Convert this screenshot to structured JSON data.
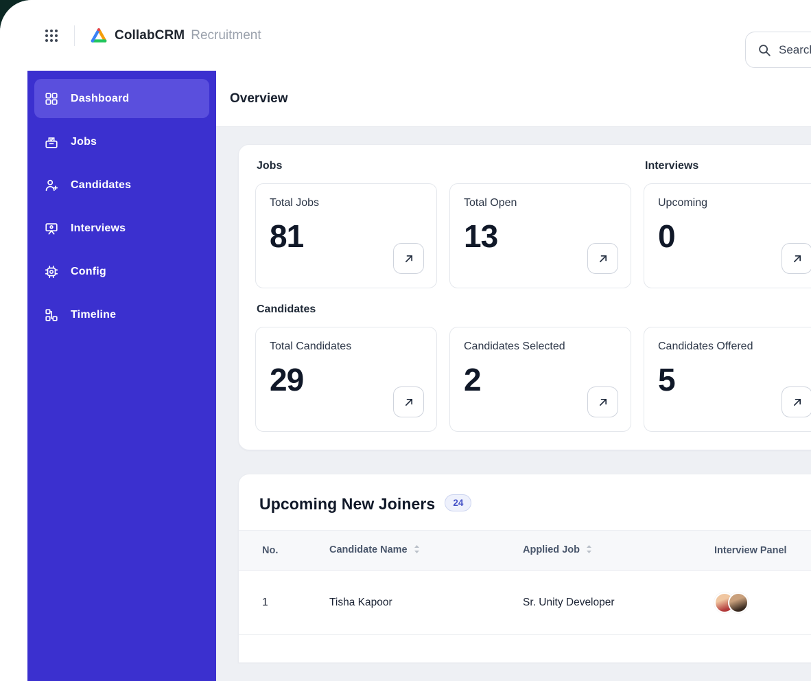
{
  "header": {
    "brand": "CollabCRM",
    "product": "Recruitment",
    "search_placeholder": "Search"
  },
  "sidebar": {
    "items": [
      {
        "label": "Dashboard",
        "icon": "dashboard-icon",
        "active": true
      },
      {
        "label": "Jobs",
        "icon": "jobs-icon",
        "active": false
      },
      {
        "label": "Candidates",
        "icon": "candidates-icon",
        "active": false
      },
      {
        "label": "Interviews",
        "icon": "interviews-icon",
        "active": false
      },
      {
        "label": "Config",
        "icon": "config-icon",
        "active": false
      },
      {
        "label": "Timeline",
        "icon": "timeline-icon",
        "active": false
      }
    ]
  },
  "page": {
    "title": "Overview"
  },
  "stats": {
    "jobs_label": "Jobs",
    "interviews_label": "Interviews",
    "candidates_label": "Candidates",
    "cards": {
      "total_jobs": {
        "title": "Total Jobs",
        "value": "81"
      },
      "total_open": {
        "title": "Total Open",
        "value": "13"
      },
      "upcoming": {
        "title": "Upcoming",
        "value": "0"
      },
      "total_candidates": {
        "title": "Total Candidates",
        "value": "29"
      },
      "candidates_selected": {
        "title": "Candidates Selected",
        "value": "2"
      },
      "candidates_offered": {
        "title": "Candidates Offered",
        "value": "5"
      }
    }
  },
  "joiners": {
    "title": "Upcoming New Joiners",
    "badge": "24",
    "columns": [
      "No.",
      "Candidate Name",
      "Applied Job",
      "Interview Panel"
    ],
    "rows": [
      {
        "no": "1",
        "name": "Tisha Kapoor",
        "job": "Sr. Unity Developer",
        "panel_avatars": 2
      }
    ]
  },
  "icons": [
    "apps-grid-icon",
    "brand-logo-icon",
    "search-icon",
    "arrow-up-right-icon",
    "sort-icon"
  ],
  "colors": {
    "sidebar": "#3b30cf",
    "sidebar_active": "#5a4fdd",
    "accent_link": "#4f46e5",
    "corner_background": "#0c2824",
    "page_background": "#eef0f4"
  }
}
